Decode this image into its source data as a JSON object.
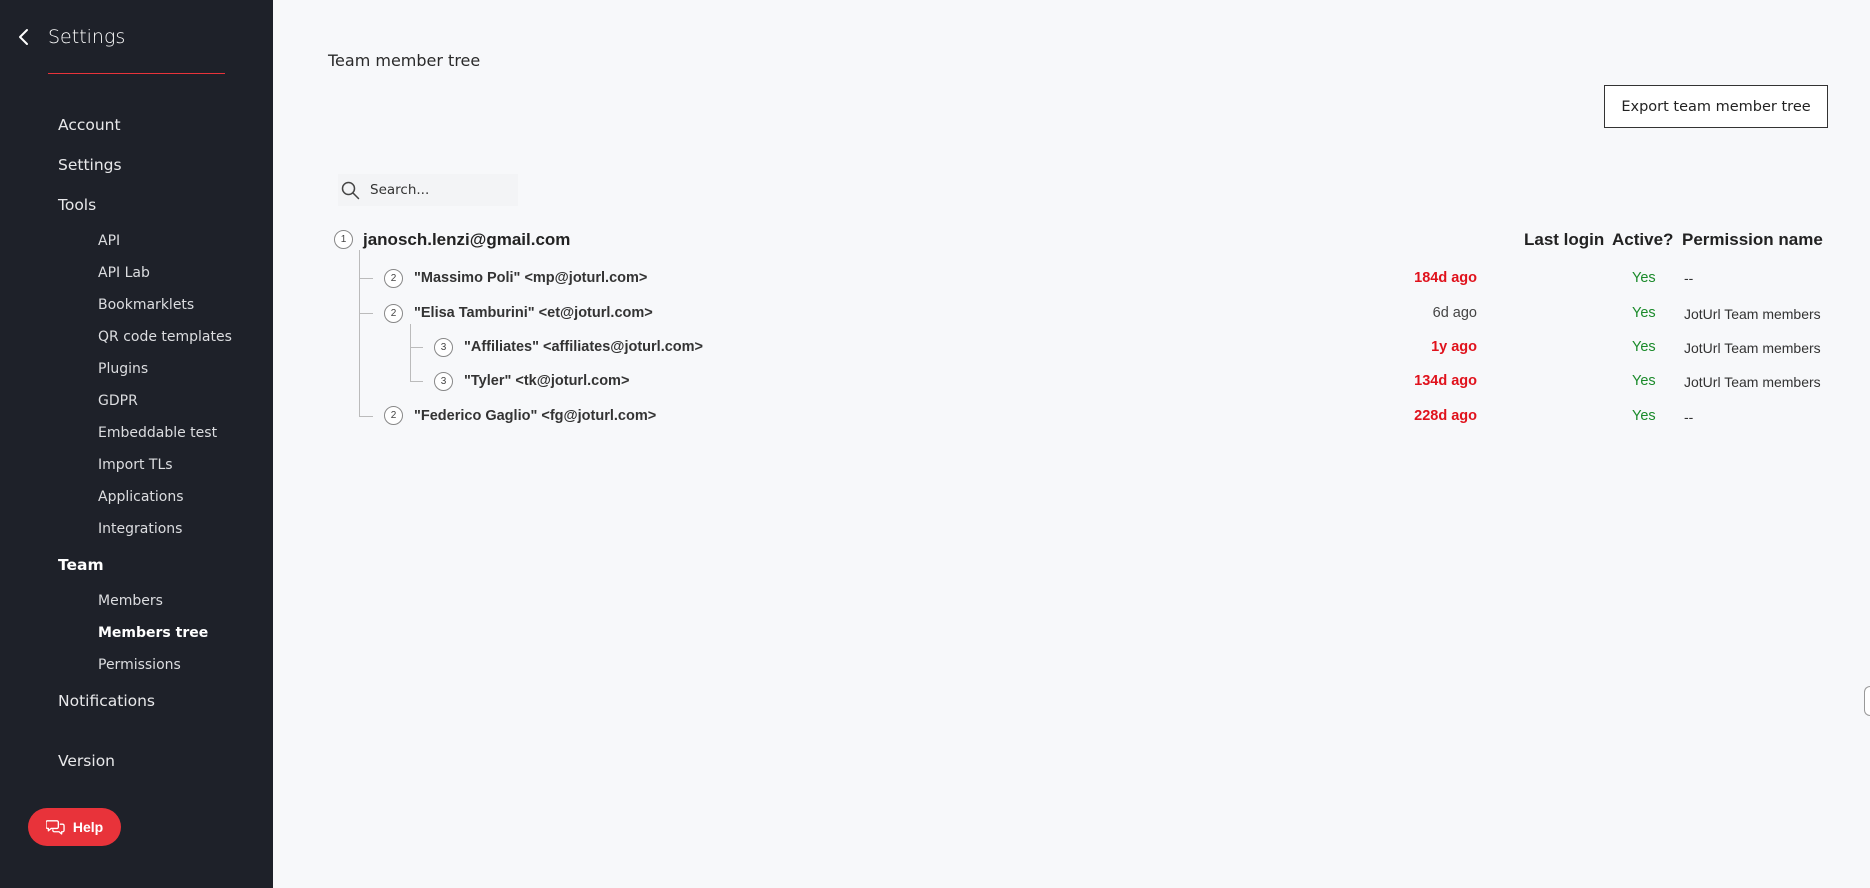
{
  "sidebar": {
    "title": "Settings",
    "top_items": [
      {
        "label": "Account"
      },
      {
        "label": "Settings"
      },
      {
        "label": "Tools"
      },
      {
        "label": "Team"
      },
      {
        "label": "Notifications"
      },
      {
        "label": "Version"
      }
    ],
    "tools_items": [
      {
        "label": "API"
      },
      {
        "label": "API Lab"
      },
      {
        "label": "Bookmarklets"
      },
      {
        "label": "QR code templates"
      },
      {
        "label": "Plugins"
      },
      {
        "label": "GDPR"
      },
      {
        "label": "Embeddable test"
      },
      {
        "label": "Import TLs"
      },
      {
        "label": "Applications"
      },
      {
        "label": "Integrations"
      }
    ],
    "team_items": [
      {
        "label": "Members"
      },
      {
        "label": "Members tree"
      },
      {
        "label": "Permissions"
      }
    ],
    "help_label": "Help",
    "accent_color": "#e8333a"
  },
  "main": {
    "title": "Team member tree",
    "export_label": "Export team member tree",
    "search_placeholder": "Search...",
    "columns": {
      "last_login": "Last login",
      "active": "Active?",
      "permission": "Permission name"
    },
    "root": {
      "level": "1",
      "label": "janosch.lenzi@gmail.com"
    },
    "rows": [
      {
        "level": "2",
        "label": "\"Massimo Poli\" <mp@joturl.com>",
        "last_login": "184d ago",
        "active": "Yes",
        "permission": "--"
      },
      {
        "level": "2",
        "label": "\"Elisa Tamburini\" <et@joturl.com>",
        "last_login": "6d ago",
        "active": "Yes",
        "permission": "JotUrl Team members"
      },
      {
        "level": "3",
        "label": "\"Affiliates\" <affiliates@joturl.com>",
        "last_login": "1y ago",
        "active": "Yes",
        "permission": "JotUrl Team members"
      },
      {
        "level": "3",
        "label": "\"Tyler\" <tk@joturl.com>",
        "last_login": "134d ago",
        "active": "Yes",
        "permission": "JotUrl Team members"
      },
      {
        "level": "2",
        "label": "\"Federico Gaglio\" <fg@joturl.com>",
        "last_login": "228d ago",
        "active": "Yes",
        "permission": "--"
      }
    ]
  }
}
